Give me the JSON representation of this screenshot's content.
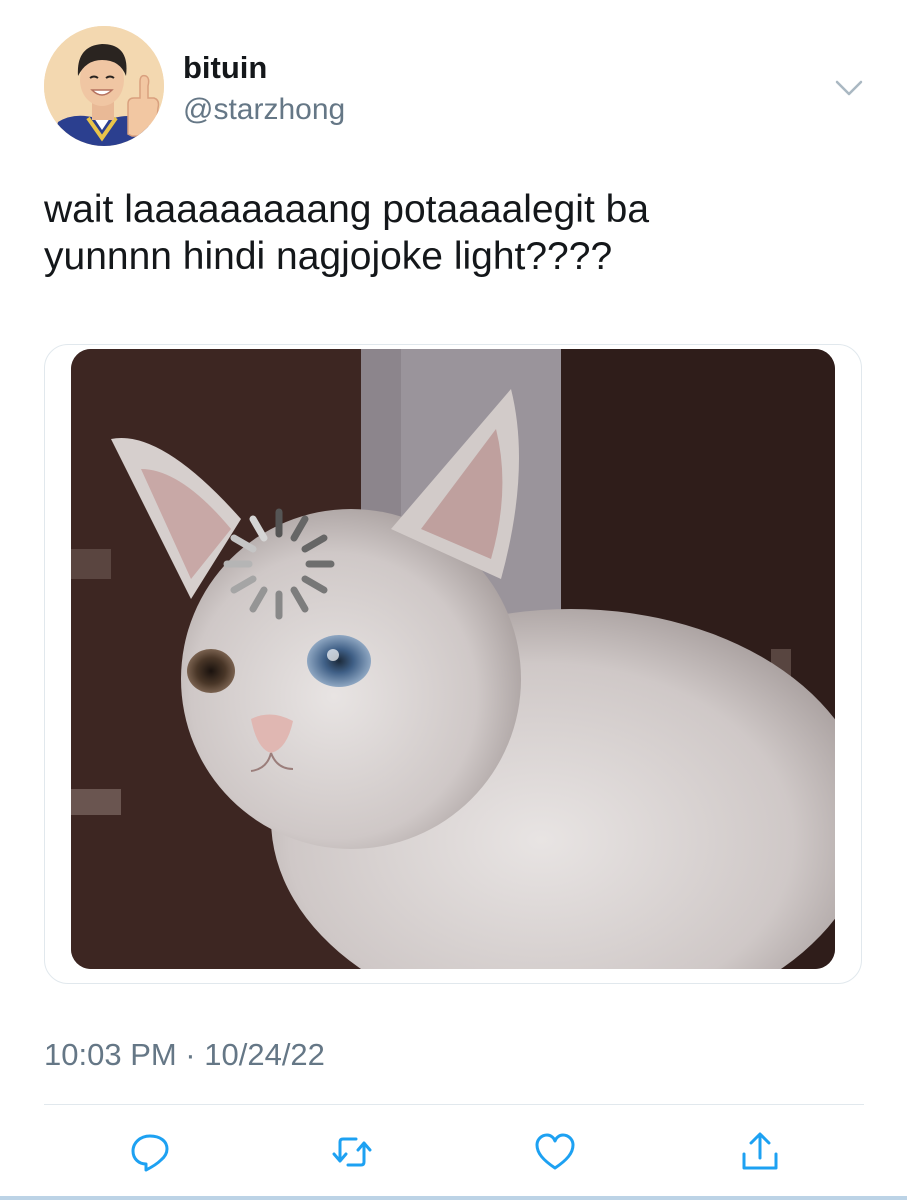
{
  "user": {
    "display_name": "bituin",
    "handle": "@starzhong"
  },
  "tweet": {
    "text_lines": [
      "wait laaaaaaaaang potaaaalegit ba",
      "yunnnn hindi nagjojoke light????"
    ],
    "timestamp": "10:03 PM · 10/24/22"
  },
  "icons": {
    "more": "chevron-down-icon",
    "reply": "reply-icon",
    "retweet": "retweet-icon",
    "like": "heart-icon",
    "share": "share-icon"
  },
  "colors": {
    "text": "#14171a",
    "secondary": "#657786",
    "icon": "#1da1f2",
    "border": "#e1e8ed"
  }
}
